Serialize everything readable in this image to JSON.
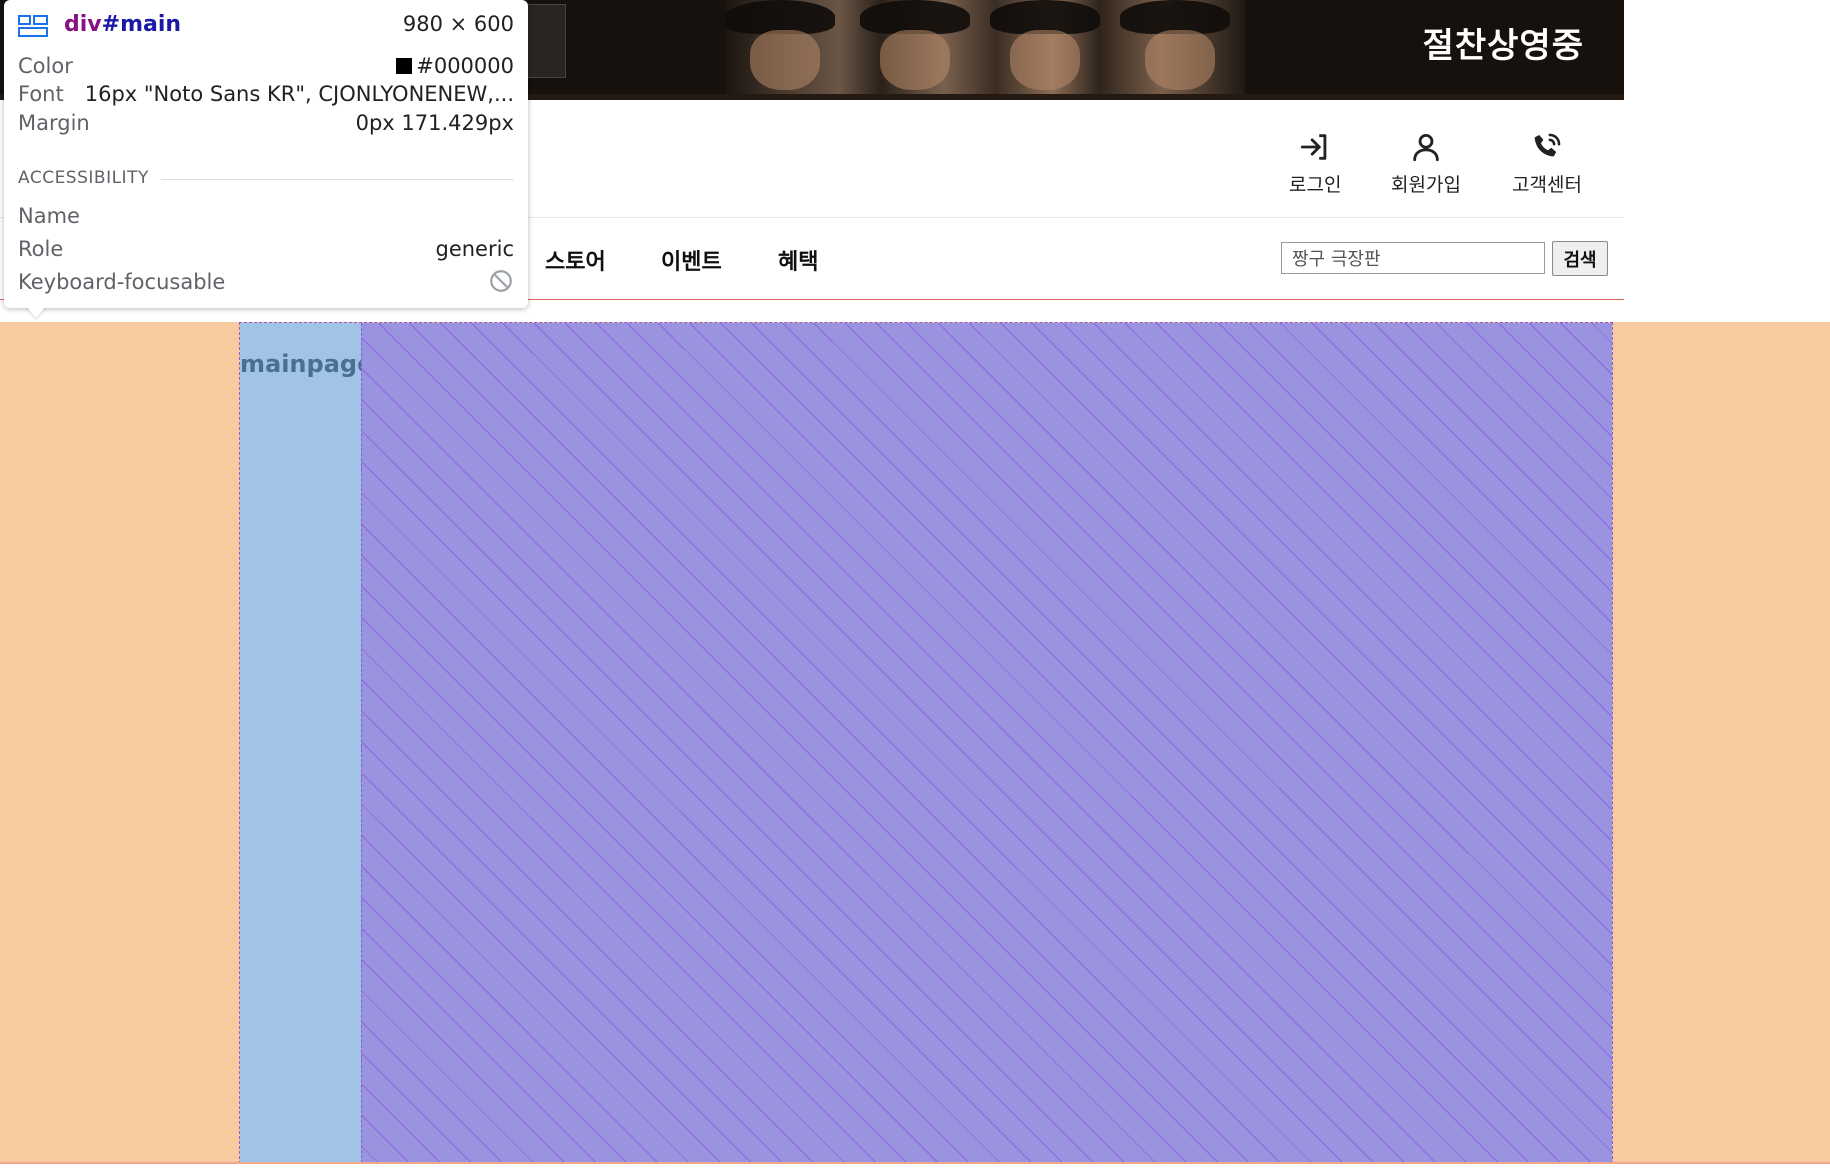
{
  "banner": {
    "text": "절찬상영중"
  },
  "member_nav": [
    {
      "icon": "login-icon",
      "label": "로그인"
    },
    {
      "icon": "user-icon",
      "label": "회원가입"
    },
    {
      "icon": "phone-icon",
      "label": "고객센터"
    }
  ],
  "main_nav": [
    {
      "label": "스토어"
    },
    {
      "label": "이벤트"
    },
    {
      "label": "혜택"
    }
  ],
  "search": {
    "value": "짱구 극장판",
    "button_label": "검색"
  },
  "page": {
    "left_label": "mainpage"
  },
  "devtools_tooltip": {
    "selector_tag": "div",
    "selector_id": "#main",
    "dimensions": "980 × 600",
    "color_key": "Color",
    "color_value": "#000000",
    "color_swatch": "#000000",
    "font_key": "Font",
    "font_value": "16px \"Noto Sans KR\", CJONLYONENEW,...",
    "margin_key": "Margin",
    "margin_value": "0px 171.429px",
    "section_title": "ACCESSIBILITY",
    "name_key": "Name",
    "name_value": "",
    "role_key": "Role",
    "role_value": "generic",
    "focusable_key": "Keyboard-focusable",
    "focusable_icon": "not-allowed-icon"
  },
  "colors": {
    "margin_highlight": "#f7cb9f",
    "padding_highlight": "#a1c3e6",
    "content_highlight": "#9a94e0",
    "nav_divider": "#e0655b"
  }
}
